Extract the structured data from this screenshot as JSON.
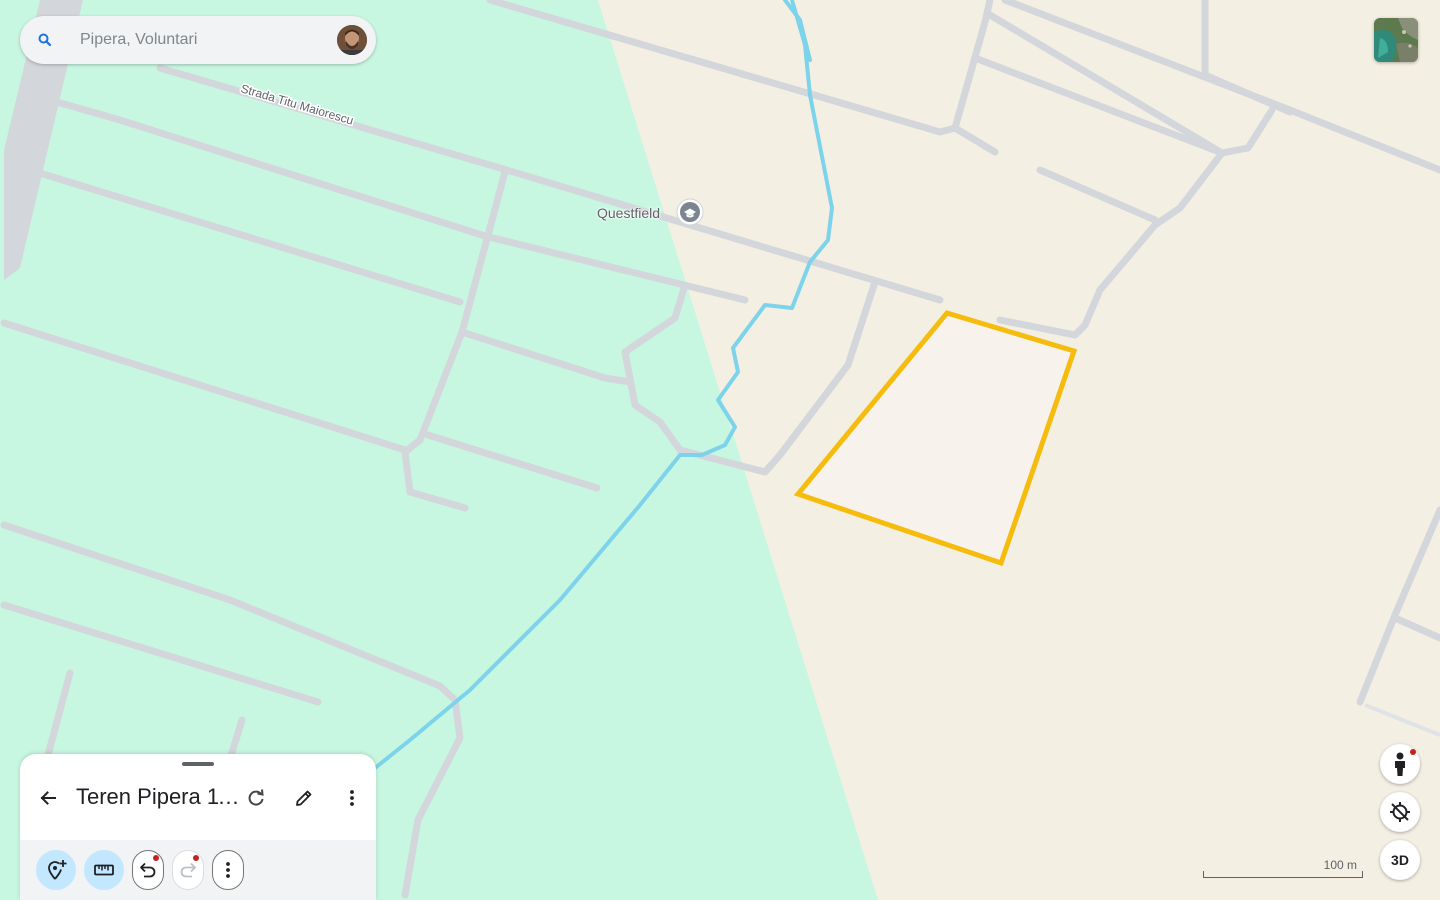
{
  "search": {
    "placeholder": "Pipera, Voluntari"
  },
  "map": {
    "street_label": "Strada Titu Maiorescu",
    "poi_label": "Questfield",
    "poi_icon": "school-icon",
    "scale_label": "100 m",
    "colors": {
      "park": "#c8f7e1",
      "land": "#f4efe3",
      "road": "#d3d6da",
      "river": "#7dd3ea",
      "polygon": "#f5bb0d"
    }
  },
  "controls": {
    "three_d_label": "3D"
  },
  "panel": {
    "title": "Teren Pipera 11..."
  }
}
